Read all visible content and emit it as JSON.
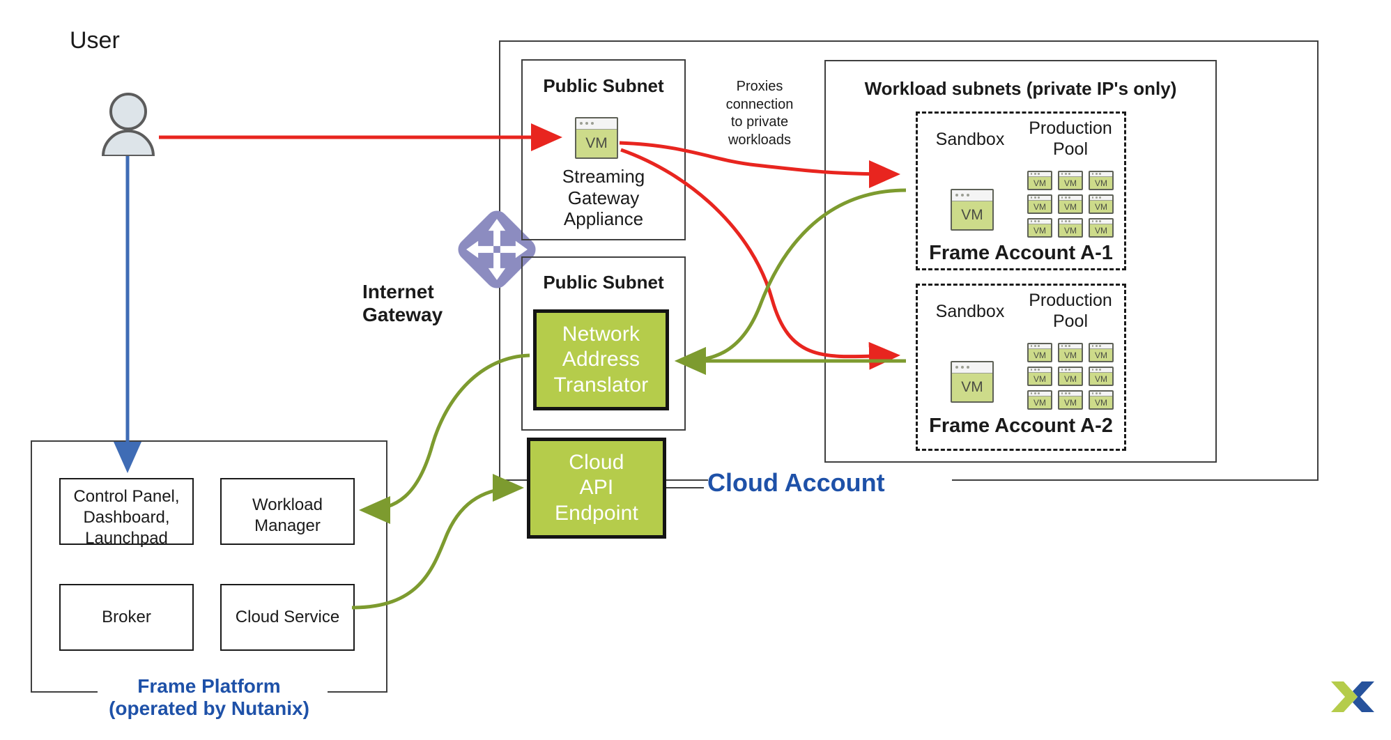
{
  "diagram": {
    "title": "Nutanix Frame cloud account network architecture",
    "colors": {
      "accent_blue": "#1e51a8",
      "arrow_red": "#e8251f",
      "arrow_green": "#7d9b2f",
      "arrow_blue": "#3f6cb5",
      "block_green": "#b5cc4b",
      "vm_green": "#cddb8a",
      "gateway_purple": "#8c8cc0",
      "border_dark": "#3f3f3f"
    }
  },
  "user": {
    "label": "User",
    "icon": "user-avatar-icon"
  },
  "internet_gateway": {
    "label": "Internet\nGateway",
    "icon": "internet-gateway-diamond-icon"
  },
  "cloud_account": {
    "label": "Cloud Account"
  },
  "public_subnet_top": {
    "title": "Public Subnet",
    "appliance": {
      "icon_label": "VM",
      "caption": "Streaming\nGateway\nAppliance"
    }
  },
  "public_subnet_bottom": {
    "title": "Public Subnet",
    "nat": {
      "label": "Network\nAddress\nTranslator"
    }
  },
  "cloud_api_endpoint": {
    "label": "Cloud\nAPI\nEndpoint"
  },
  "annotation": {
    "proxies_note": "Proxies\nconnection\nto private\nworkloads"
  },
  "workload_subnets": {
    "title": "Workload subnets (private IP's only)",
    "accounts": [
      {
        "name": "Frame Account A-1",
        "sandbox_label": "Sandbox",
        "sandbox_vm_label": "VM",
        "pool_label": "Production\nPool",
        "pool_vm_label": "VM",
        "pool_rows": 3,
        "pool_cols": 3
      },
      {
        "name": "Frame Account A-2",
        "sandbox_label": "Sandbox",
        "sandbox_vm_label": "VM",
        "pool_label": "Production\nPool",
        "pool_vm_label": "VM",
        "pool_rows": 3,
        "pool_cols": 3
      }
    ]
  },
  "frame_platform": {
    "caption_line1": "Frame Platform",
    "caption_line2": "(operated by Nutanix)",
    "components": [
      {
        "label": "Control Panel,\nDashboard,\nLaunchpad"
      },
      {
        "label": "Workload\nManager"
      },
      {
        "label": "Broker"
      },
      {
        "label": "Cloud Service"
      }
    ]
  },
  "logo": {
    "name": "nutanix-x-logo",
    "green": "#b5cc4b",
    "blue": "#26529c"
  }
}
